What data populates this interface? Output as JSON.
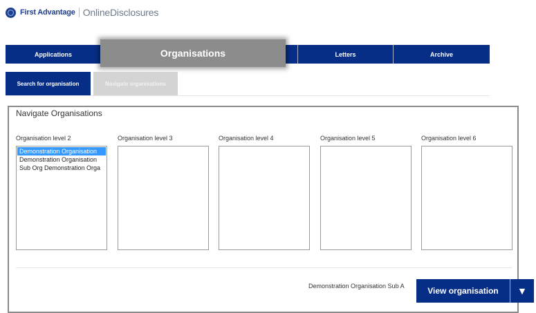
{
  "header": {
    "brand_name": "First Advantage",
    "product_name": "OnlineDisclosures",
    "logo_icon": "globe-logo-icon"
  },
  "nav": {
    "items": [
      {
        "label": "Applications"
      },
      {
        "label": "Organisations",
        "active": true
      },
      {
        "label": "Letters"
      },
      {
        "label": "Archive"
      }
    ],
    "accent_color": "#062e86"
  },
  "subtabs": {
    "search_label": "Search for organisation",
    "navigate_label": "Navigate organisations"
  },
  "panel": {
    "title": "Navigate Organisations",
    "columns": [
      {
        "label": "Organisation level 2",
        "options": [
          "Demonstration Organisation",
          "Demonstration Organisation",
          "Sub Org Demonstration Orga"
        ],
        "selected_index": 0
      },
      {
        "label": "Organisation level 3",
        "options": []
      },
      {
        "label": "Organisation level 4",
        "options": []
      },
      {
        "label": "Organisation level 5",
        "options": []
      },
      {
        "label": "Organisation level 6",
        "options": []
      }
    ],
    "summary_text": "Demonstration Organisation Sub A"
  },
  "actions": {
    "view_label": "View organisation",
    "dropdown_icon": "caret-down-icon"
  }
}
